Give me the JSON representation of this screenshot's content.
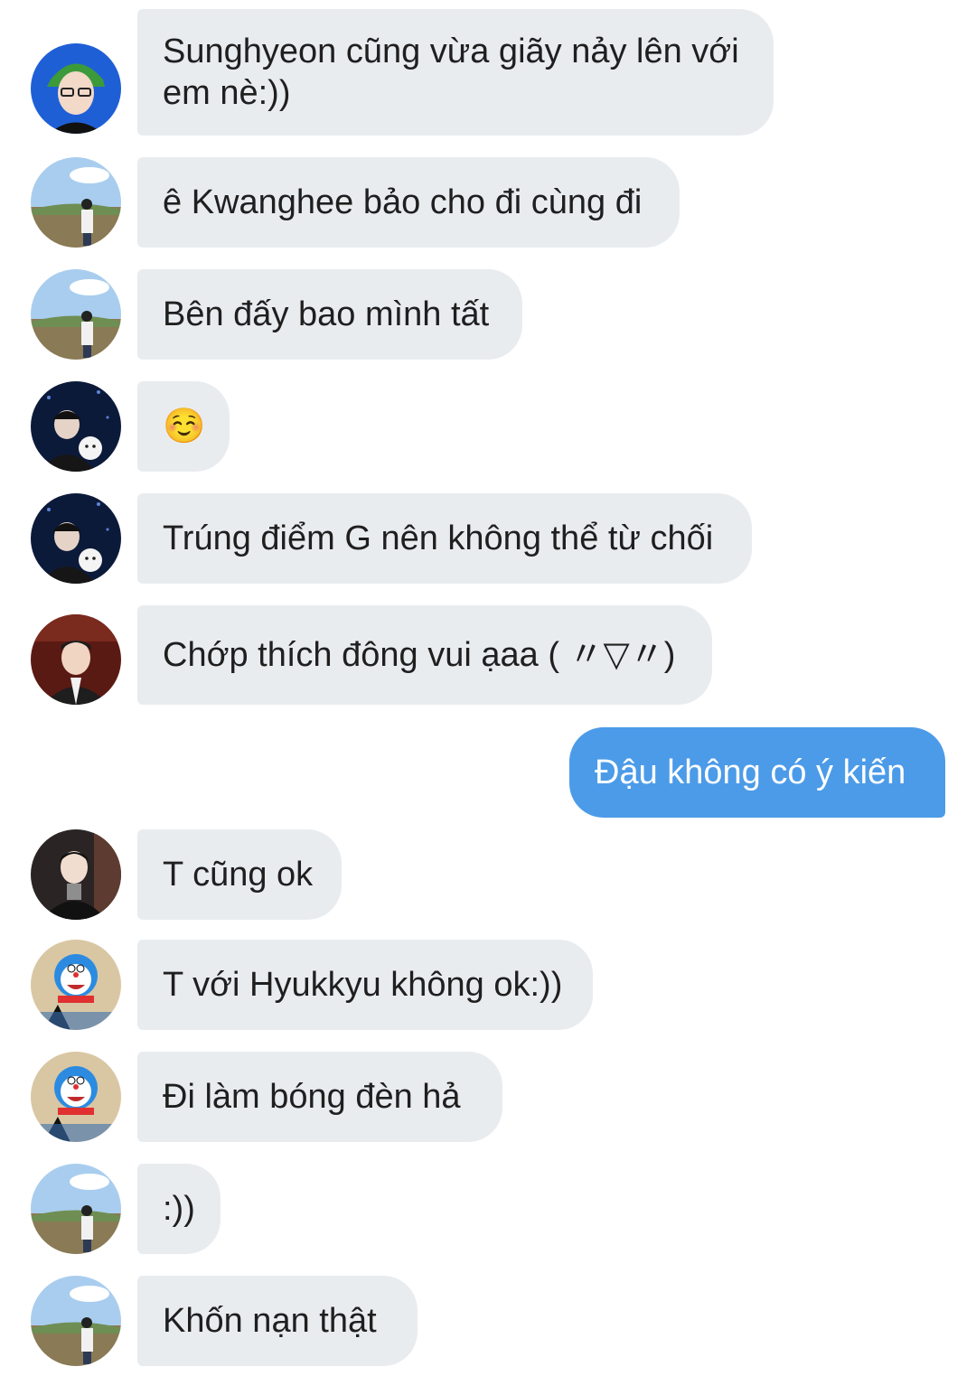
{
  "conversation": {
    "messages": [
      {
        "text": "Sunghyeon cũng vừa giãy nảy lên với em nè:))",
        "avatar": "avatar-green-hat"
      },
      {
        "text": "ê Kwanghee bảo cho đi cùng đi",
        "avatar": "avatar-field"
      },
      {
        "text": "Bên đấy bao mình tất",
        "avatar": "avatar-field"
      },
      {
        "text": "☺️",
        "avatar": "avatar-night"
      },
      {
        "text": "Trúng điểm G nên không thể từ chối",
        "avatar": "avatar-night"
      },
      {
        "text": "Chớp thích đông vui ạaa ( 〃▽〃)",
        "avatar": "avatar-red-room"
      },
      {
        "text": "Đậu không có ý kiến",
        "outgoing": true
      },
      {
        "text": "T cũng ok",
        "avatar": "avatar-dark-suit"
      },
      {
        "text": "T với Hyukkyu không ok:))",
        "avatar": "avatar-doraemon"
      },
      {
        "text": "Đi làm bóng đèn hả",
        "avatar": "avatar-doraemon"
      },
      {
        "text": ":))",
        "avatar": "avatar-field"
      },
      {
        "text": "Khốn nạn thật",
        "avatar": "avatar-field"
      }
    ]
  },
  "colors": {
    "incoming_bubble": "#e9ecef",
    "outgoing_bubble": "#4c9be8",
    "incoming_text": "#1f1f1f",
    "outgoing_text": "#ffffff"
  }
}
